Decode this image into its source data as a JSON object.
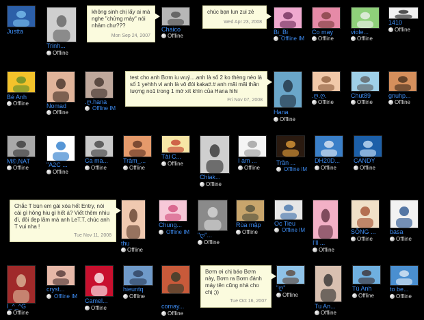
{
  "status_offline": "Offline",
  "status_offline_im": "Offline IM",
  "friends": [
    {
      "name": "Justta",
      "status": "none",
      "colors": [
        "#2c5fa8",
        "#7ec3f2"
      ]
    },
    {
      "name": "Trinh...",
      "status": "offline",
      "colors": [
        "#cfcfcf",
        "#5d5d5d"
      ]
    },
    {
      "name": "Chaico",
      "status": "offline",
      "colors": [
        "#b7b7b7",
        "#4c4c4c"
      ]
    },
    {
      "name": "Bi_Bi",
      "status": "offline_im",
      "colors": [
        "#f0a9cf",
        "#6b2a55"
      ]
    },
    {
      "name": "Co may",
      "status": "offline",
      "colors": [
        "#e68aa7",
        "#7a3b3b"
      ]
    },
    {
      "name": "viole...",
      "status": "offline",
      "colors": [
        "#8fd07a",
        "#f3f3f3"
      ]
    },
    {
      "name": "1410",
      "status": "offline",
      "colors": [
        "#f2f2f2",
        "#1b1b1b"
      ]
    },
    {
      "name": "Bé Anh",
      "status": "offline",
      "colors": [
        "#f3c22b",
        "#5a8a2b"
      ]
    },
    {
      "name": "Nomad",
      "status": "offline",
      "colors": [
        "#e1b49a",
        "#3a2a22"
      ]
    },
    {
      "name": ".ღ.hana",
      "status": "offline_im",
      "colors": [
        "#bfa89c",
        "#3b2c26"
      ]
    },
    {
      "name": "Hana",
      "status": "offline",
      "colors": [
        "#6aa6c9",
        "#1e2b3a"
      ]
    },
    {
      "name": ".ღ.ღ.",
      "status": "offline",
      "colors": [
        "#f1c9a9",
        "#8a5a3a"
      ]
    },
    {
      "name": "Chut89",
      "status": "offline",
      "colors": [
        "#9fd0e8",
        "#5b5b5b"
      ]
    },
    {
      "name": "gnuhp...",
      "status": "offline",
      "colors": [
        "#d58f5c",
        "#3e2a1a"
      ]
    },
    {
      "name": "M©.NAT",
      "status": "offline",
      "colors": [
        "#a9a9a9",
        "#333333"
      ]
    },
    {
      "name": "\"A2C ...",
      "status": "offline",
      "colors": [
        "#ffffff",
        "#1e73c8"
      ]
    },
    {
      "name": "Ca ma...",
      "status": "offline",
      "colors": [
        "#c9c9c9",
        "#3c3c3c"
      ]
    },
    {
      "name": "Tràm_...",
      "status": "offline",
      "colors": [
        "#e59a6b",
        "#5a3020"
      ]
    },
    {
      "name": "Tài C...",
      "status": "offline",
      "colors": [
        "#f6e6a6",
        "#c23a2a"
      ]
    },
    {
      "name": "Chiak...",
      "status": "offline",
      "colors": [
        "#cfcfcf",
        "#2b2b2b"
      ]
    },
    {
      "name": "I am ...",
      "status": "offline",
      "colors": [
        "#f5f5f5",
        "#9a9a9a"
      ]
    },
    {
      "name": "Trần ...",
      "status": "offline_im",
      "colors": [
        "#2a1a10",
        "#e9a23a"
      ]
    },
    {
      "name": "DH20D...",
      "status": "offline",
      "colors": [
        "#3a7fc8",
        "#e9eef5"
      ]
    },
    {
      "name": "CANDY",
      "status": "offline",
      "colors": [
        "#1c5fa8",
        "#cfe6fb"
      ]
    },
    {
      "name": "thu",
      "status": "offline",
      "colors": [
        "#f0c9b0",
        "#5b3a2a"
      ]
    },
    {
      "name": "Chung...",
      "status": "offline_im",
      "colors": [
        "#f7c8d8",
        "#d04a7a"
      ]
    },
    {
      "name": "\"ღ\"...",
      "status": "offline",
      "colors": [
        "#8a8a8a",
        "#dedede"
      ]
    },
    {
      "name": "Rùa mập",
      "status": "offline",
      "colors": [
        "#c8a56c",
        "#4d4d3b"
      ]
    },
    {
      "name": "Oc Tieu",
      "status": "offline_im",
      "colors": [
        "#e6e6e6",
        "#3b6da8"
      ]
    },
    {
      "name": "I'll ...",
      "status": "offline",
      "colors": [
        "#f3b0c6",
        "#5a2a3a"
      ]
    },
    {
      "name": "SÔNG ...",
      "status": "offline",
      "colors": [
        "#f0e0c8",
        "#a04a2a"
      ]
    },
    {
      "name": "basa",
      "status": "offline",
      "colors": [
        "#f2f2f2",
        "#1f4c8a"
      ]
    },
    {
      "name": "I_^_^G",
      "status": "offline",
      "colors": [
        "#a02a2a",
        "#e0c0a0"
      ]
    },
    {
      "name": "cryst...",
      "status": "offline_im",
      "colors": [
        "#e6b8a8",
        "#4a3030"
      ]
    },
    {
      "name": "Camel...",
      "status": "offline",
      "colors": [
        "#c8102e",
        "#ffffff"
      ]
    },
    {
      "name": "hieuntq",
      "status": "offline",
      "colors": [
        "#6f9ac9",
        "#2a3a55"
      ]
    },
    {
      "name": "comay...",
      "status": "offline",
      "colors": [
        "#c85a3a",
        "#2a3a2a"
      ]
    },
    {
      "name": "\"ღ\"",
      "status": "offline",
      "colors": [
        "#8fc3e8",
        "#5a4030"
      ]
    },
    {
      "name": "Tu An...",
      "status": "offline",
      "colors": [
        "#d8c0b0",
        "#2a2a2a"
      ]
    },
    {
      "name": "Tú Anh",
      "status": "offline",
      "colors": [
        "#6fb0e0",
        "#3a2a2a"
      ]
    },
    {
      "name": "to be...",
      "status": "offline",
      "colors": [
        "#4a8fd0",
        "#e8f0f8"
      ]
    }
  ],
  "bubbles": [
    {
      "text": "không sinh chị lấy ai mà nghe \"chửng mày\" nói nhảm chư???",
      "date": "Mon Sep 24, 2007"
    },
    {
      "text": "chúc bạn lun zui zẻ",
      "date": "Wed Apr 23, 2008"
    },
    {
      "text": "test cho anh Bơm iu wuý....anh là số 2 ko thèng nèo là số 1 yehhh vì anh là vô đói kaka#.# anh mãi mãi thần tượng no1 trong 1 mớ xít khìn của Hana hihi",
      "date": "Fri Nov 07, 2008"
    },
    {
      "text": "Chắc T bùn em gái xóa hết Entry, nói cái gì hông hiu gì hết á? Viết thêm nhìu đi, đôi đẹp lâm mà anh LeT.T, chúc anh T vui nha !",
      "date": "Tue Nov 11, 2008"
    },
    {
      "text": "Bơm ơi chị báo Bơm này, Bơm ra Bơm đánh máy tên cũng nhà cho chị ;))",
      "date": "Tue Oct 16, 2007"
    }
  ]
}
